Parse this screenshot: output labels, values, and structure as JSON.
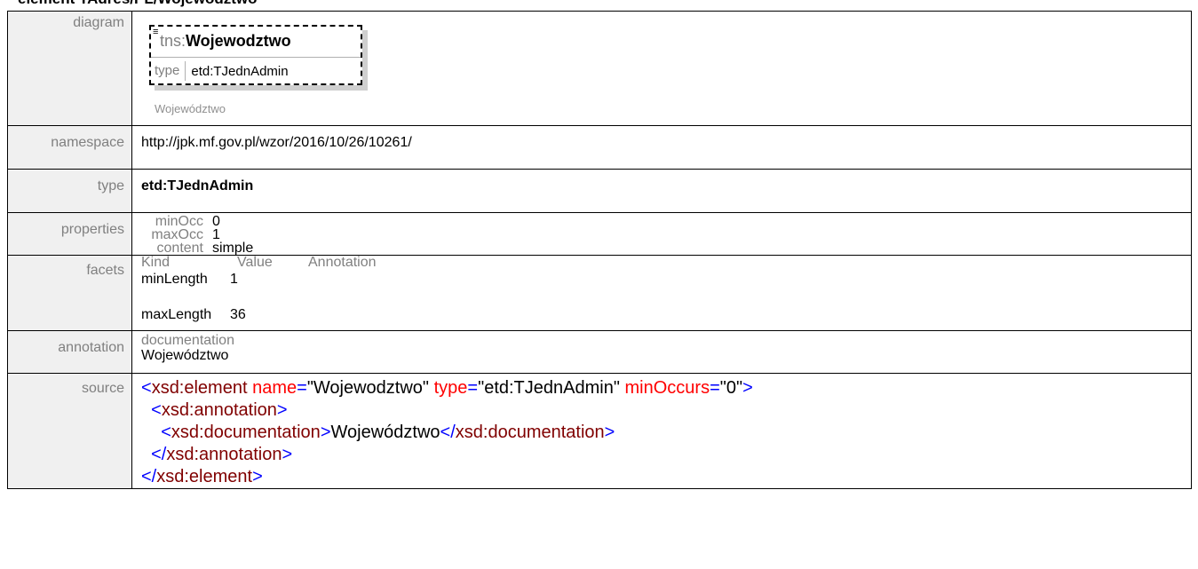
{
  "header": {
    "title": "element TAdres/PL/Wojewodztwo"
  },
  "labels": {
    "diagram": "diagram",
    "namespace": "namespace",
    "type": "type",
    "properties": "properties",
    "facets": "facets",
    "annotation": "annotation",
    "source": "source"
  },
  "diagram": {
    "prefix": "tns:",
    "local_name": "Wojewodztwo",
    "type_label": "type",
    "type_value": "etd:TJednAdmin",
    "caption": "Województwo"
  },
  "namespace": "http://jpk.mf.gov.pl/wzor/2016/10/26/10261/",
  "type": "etd:TJednAdmin",
  "properties": [
    {
      "key": "minOcc",
      "value": "0"
    },
    {
      "key": "maxOcc",
      "value": "1"
    },
    {
      "key": "content",
      "value": "simple"
    }
  ],
  "facets": {
    "headers": [
      "Kind",
      "Value",
      "Annotation"
    ],
    "rows": [
      {
        "kind": "minLength",
        "value": "1"
      },
      {
        "kind": "maxLength",
        "value": "36"
      }
    ]
  },
  "annotation": {
    "label": "documentation",
    "text": "Województwo"
  },
  "source": {
    "line1": {
      "open": "<",
      "tag": "xsd:element",
      "a1": "name",
      "eq": "=",
      "v1": "\"Wojewodztwo\"",
      "a2": "type",
      "v2": "\"etd:TJednAdmin\"",
      "a3": "minOccurs",
      "v3": "\"0\"",
      "close": ">"
    },
    "line2": {
      "open": "<",
      "tag": "xsd:annotation",
      "close": ">"
    },
    "line3": {
      "open": "<",
      "tag": "xsd:documentation",
      "close": ">",
      "text": "Województwo",
      "open2": "</",
      "tag2": "xsd:documentation",
      "close2": ">"
    },
    "line4": {
      "open": "</",
      "tag": "xsd:annotation",
      "close": ">"
    },
    "line5": {
      "open": "</",
      "tag": "xsd:element",
      "close": ">"
    }
  }
}
